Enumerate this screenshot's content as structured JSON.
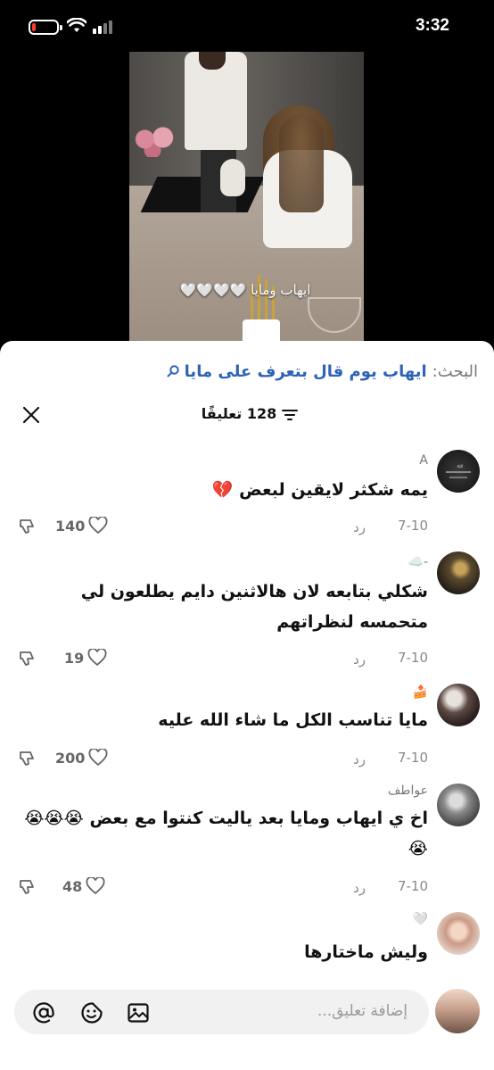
{
  "status_bar": {
    "time": "3:32"
  },
  "video": {
    "caption": "ايهاب ومايا 🤍🤍🤍🤍"
  },
  "search": {
    "label": "البحث:",
    "query": "ايهاب يوم قال بتعرف على مايا"
  },
  "header": {
    "count_label": "128 تعليقًا"
  },
  "comments": [
    {
      "name": "A",
      "text": "يمه شكثر لايقين لبعض 💔",
      "date": "7-10",
      "reply": "رد",
      "likes": "140"
    },
    {
      "name": "-☁️",
      "text": "شكلي بتابعه لان هالاثنين دايم يطلعون لي متحمسه لنظراتهم",
      "date": "7-10",
      "reply": "رد",
      "likes": "19"
    },
    {
      "name": "🍰",
      "text": "مايا تناسب الكل ما شاء الله عليه",
      "date": "7-10",
      "reply": "رد",
      "likes": "200"
    },
    {
      "name": "عواطف",
      "text": "اخ ي ايهاب ومايا بعد ياليت كنتوا مع بعض 😭😭😭😭",
      "date": "7-10",
      "reply": "رد",
      "likes": "48"
    },
    {
      "name": "🤍",
      "text": "وليش ماختارها"
    }
  ],
  "input": {
    "placeholder": "إضافة تعليق..."
  },
  "colors": {
    "accent": "#2e63b8",
    "sheet_bg": "#ffffff",
    "battery_low": "#ff3b30"
  }
}
